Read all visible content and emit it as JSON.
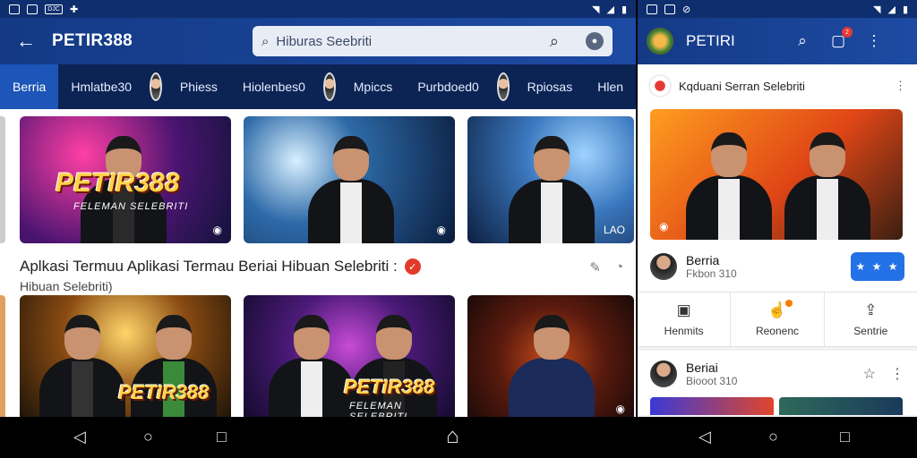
{
  "left": {
    "status": {
      "left_text": "DJC"
    },
    "back_icon": "arrow-left-icon",
    "title": "PETIR388",
    "search": {
      "value": "Hiburas Seebriti"
    },
    "tabs": [
      {
        "label": "Berria",
        "active": true
      },
      {
        "label": "Hmlatbe30"
      },
      {
        "label": "Phiess"
      },
      {
        "label": "Hiolenbes0"
      },
      {
        "label": "Mpiccs"
      },
      {
        "label": "Purbdoed0"
      },
      {
        "label": "Rpiosas"
      },
      {
        "label": "Hlen"
      }
    ],
    "thumbs_row1": [
      {
        "brand": "PETIR388",
        "sub": "FELEMAN SELEBRITI"
      },
      {
        "brand": "",
        "sub": ""
      },
      {
        "brand": "",
        "sub": "",
        "overlay": "LAO"
      }
    ],
    "headline": {
      "title": "Aplkasi Termuu Aplikasi Termau Beriai Hibuan Selebriti :",
      "subtitle": "Hibuan Selebriti)"
    },
    "thumbs_row2": [
      {
        "brand": "PETIR388",
        "sub": ""
      },
      {
        "brand": "PETIR388",
        "sub": "FELEMAN SELEBRITI"
      },
      {
        "brand": "",
        "sub": ""
      }
    ]
  },
  "right": {
    "title": "PETIRI",
    "badge": "2",
    "post_header": "Kqduani Serran Selebriti",
    "profile": {
      "name": "Berria",
      "sub": "Fkbon 310",
      "follow": "★ ★ ★"
    },
    "actions": [
      {
        "label": "Henmits",
        "icon": "news-icon"
      },
      {
        "label": "Reonenc",
        "icon": "like-icon"
      },
      {
        "label": "Sentrie",
        "icon": "share-icon"
      }
    ],
    "profile2": {
      "name": "Beriai",
      "sub": "Biooot 310"
    }
  },
  "colors": {
    "appbar": "#1d4aa3",
    "tabbar": "#0c2454",
    "accent": "#2371e6",
    "active_tab": "#1d55b8"
  }
}
